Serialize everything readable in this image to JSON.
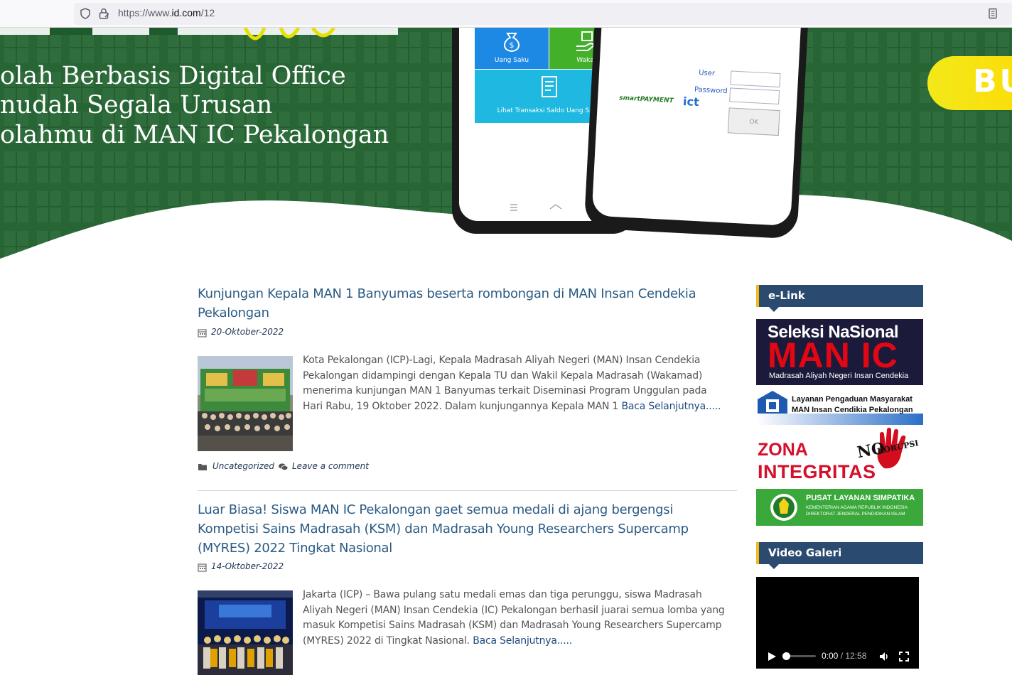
{
  "browser": {
    "url_prefix": "https://www.",
    "url_domain": "id.com",
    "url_path": "/12"
  },
  "hero": {
    "lines": [
      "olah Berbasis Digital Office",
      "nudah Segala Urusan",
      "olahmu di MAN IC Pekalongan"
    ],
    "button_text": "BU",
    "phone_tiles": {
      "uang_saku": "Uang Saku",
      "wakaf": "Wakaf",
      "transaksi": "Lihat Transaksi Saldo Uang Saku"
    },
    "login": {
      "user_label": "User",
      "password_label": "Password",
      "ok_label": "OK",
      "logo1": "smartPAYMENT",
      "logo2": "ict"
    }
  },
  "posts": [
    {
      "title": "Kunjungan Kepala MAN 1 Banyumas beserta rombongan di MAN Insan Cendekia Pekalongan",
      "date": "20-Oktober-2022",
      "excerpt": "Kota Pekalongan (ICP)-Lagi, Kepala Madrasah Aliyah Negeri (MAN) Insan Cendekia Pekalongan didampingi dengan Kepala TU dan Wakil Kepala Madrasah (Wakamad) menerima kunjungan MAN 1 Banyumas terkait Diseminasi Program Unggulan pada Hari Rabu, 19 Oktober 2022. Dalam kunjungannya Kepala MAN 1",
      "read_more": "Baca Selanjutnya.....",
      "category": "Uncategorized",
      "comment": "Leave a comment"
    },
    {
      "title": "Luar Biasa! Siswa MAN IC Pekalongan gaet semua medali di ajang bergengsi Kompetisi Sains Madrasah (KSM) dan Madrasah Young Researchers Supercamp (MYRES) 2022 Tingkat Nasional",
      "date": "14-Oktober-2022",
      "excerpt": "Jakarta (ICP) – Bawa pulang satu medali emas dan tiga perunggu, siswa Madrasah Aliyah Negeri (MAN) Insan Cendekia (IC) Pekalongan berhasil juarai semua lomba yang masuk Kompetisi Sains Madrasah (KSM) dan Madrasah Young Researchers Supercamp (MYRES) 2022 di Tingkat Nasional.",
      "read_more": "Baca Selanjutnya....."
    }
  ],
  "sidebar": {
    "elink_title": "e-Link",
    "banners": {
      "seleksi_top": "Seleksi NaSional",
      "seleksi_main": "MAN IC",
      "seleksi_sub": "Madrasah Aliyah Negeri Insan Cendekia",
      "pengaduan_line1": "Layanan Pengaduan Masyarakat",
      "pengaduan_line2": "MAN Insan Cendikia Pekalongan",
      "zona_line1": "ZONA",
      "zona_line2": "INTEGRITAS",
      "zona_no": "NO",
      "zona_korupsi": "KORUPSI",
      "simpatika_line1": "PUSAT LAYANAN SIMPATIKA",
      "simpatika_line2": "KEMENTERIAN AGAMA REPUBLIK INDONESIA",
      "simpatika_line3": "DIREKTORAT JENDERAL PENDIDIKAN ISLAM"
    },
    "video_title": "Video Galeri",
    "video": {
      "current_time": "0:00",
      "separator": " / ",
      "duration": "12:58",
      "progress": 0
    }
  },
  "colors": {
    "link_title": "#2b5b84",
    "widget_bg": "#2b4a6f",
    "widget_accent": "#f0b91c",
    "hero_green": "#2f6d3c"
  }
}
